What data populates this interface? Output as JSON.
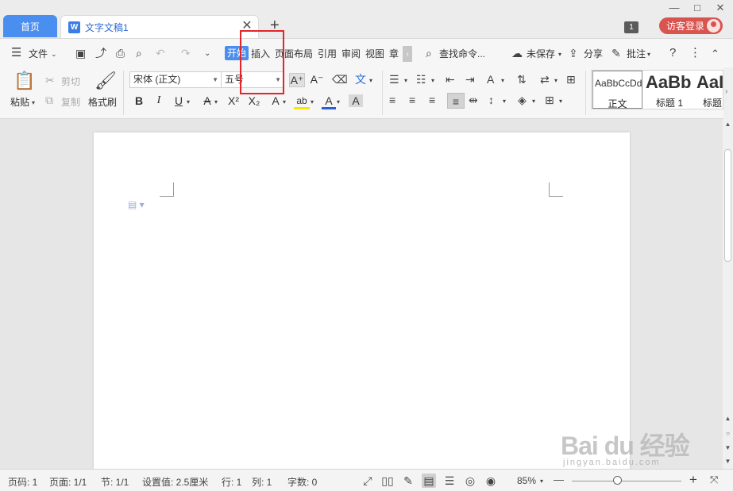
{
  "tabs": {
    "home": "首页",
    "doc_icon": "W",
    "doc_title": "文字文稿1",
    "close": "✕",
    "add": "+"
  },
  "titlebar": {
    "badge": "1",
    "login": "访客登录",
    "minimize": "—",
    "maximize": "□"
  },
  "menu": {
    "file": "文件",
    "items": [
      "开始",
      "插入",
      "页面布局",
      "引用",
      "审阅",
      "视图",
      "章"
    ],
    "more": "›",
    "search": "查找命令...",
    "unsaved": "未保存",
    "share": "分享",
    "comment": "批注",
    "help": "?",
    "more_menu": "⋮",
    "collapse": "⌃"
  },
  "ribbon": {
    "paste": "粘贴",
    "cut": "剪切",
    "copy": "复制",
    "format_painter": "格式刷",
    "font_name": "宋体 (正文)",
    "font_size": "五号",
    "bold": "B",
    "italic": "I",
    "underline": "U",
    "strike": "A",
    "superscript": "X²",
    "subscript": "X₂",
    "text_effect": "A",
    "highlight": "ab",
    "font_color": "A",
    "char_shading": "A",
    "grow": "A⁺",
    "shrink": "A⁻",
    "phonetic": "文",
    "styles": [
      {
        "preview": "AaBbCcDd",
        "label": "正文"
      },
      {
        "preview": "AaBb",
        "label": "标题 1"
      },
      {
        "preview": "AaI",
        "label": "标题"
      }
    ],
    "styles_scroll": "›"
  },
  "status": {
    "page_num": "页码: 1",
    "pages": "页面: 1/1",
    "section": "节: 1/1",
    "setting": "设置值: 2.5厘米",
    "row": "行: 1",
    "col": "列: 1",
    "words": "字数: 0",
    "zoom": "85%",
    "zoom_out": "—",
    "zoom_in": "+",
    "zoom_level": 0.4
  },
  "watermark": {
    "brand": "Bai du 经验",
    "url": "jingyan.baidu.com"
  },
  "colors": {
    "accent": "#4a8ef0",
    "login": "#d9534f",
    "highlight_box": "#e3242b"
  }
}
